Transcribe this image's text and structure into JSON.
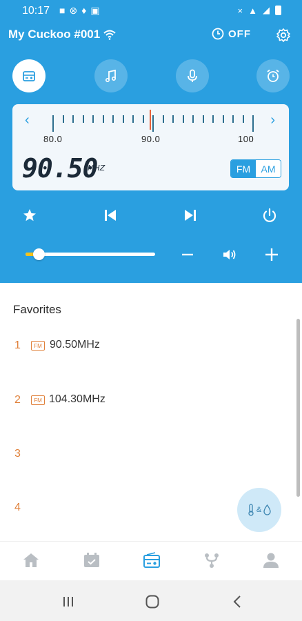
{
  "status_bar": {
    "time": "10:17",
    "left_icons": [
      "bag-icon",
      "x-circle-icon",
      "bell-icon",
      "image-icon"
    ],
    "right_icons": [
      "mute-icon",
      "wifi-icon",
      "signal-icon",
      "battery-icon"
    ]
  },
  "header": {
    "device_name": "My Cuckoo #001",
    "timer_label": "OFF"
  },
  "mode_tabs": [
    {
      "name": "radio",
      "active": true
    },
    {
      "name": "music",
      "active": false
    },
    {
      "name": "microphone",
      "active": false
    },
    {
      "name": "alarm",
      "active": false
    }
  ],
  "tuner": {
    "scale_labels": [
      "80.0",
      "90.0",
      "100"
    ],
    "frequency": "90.50",
    "unit": "MHZ",
    "band_fm": "FM",
    "band_am": "AM",
    "selected_band": "FM"
  },
  "volume": {
    "level_fraction": 0.1
  },
  "favorites": {
    "title": "Favorites",
    "items": [
      {
        "number": "1",
        "tag": "FM",
        "frequency": "90.50MHz"
      },
      {
        "number": "2",
        "tag": "FM",
        "frequency": "104.30MHz"
      },
      {
        "number": "3",
        "tag": "",
        "frequency": ""
      },
      {
        "number": "4",
        "tag": "",
        "frequency": ""
      }
    ]
  },
  "fab": {
    "label": "&"
  },
  "bottom_nav": [
    "home-icon",
    "calendar-icon",
    "radio-icon",
    "connect-icon",
    "profile-icon"
  ],
  "colors": {
    "primary": "#2a9fe0",
    "accent_orange": "#e0803a",
    "volume_fill": "#f6c21a"
  }
}
